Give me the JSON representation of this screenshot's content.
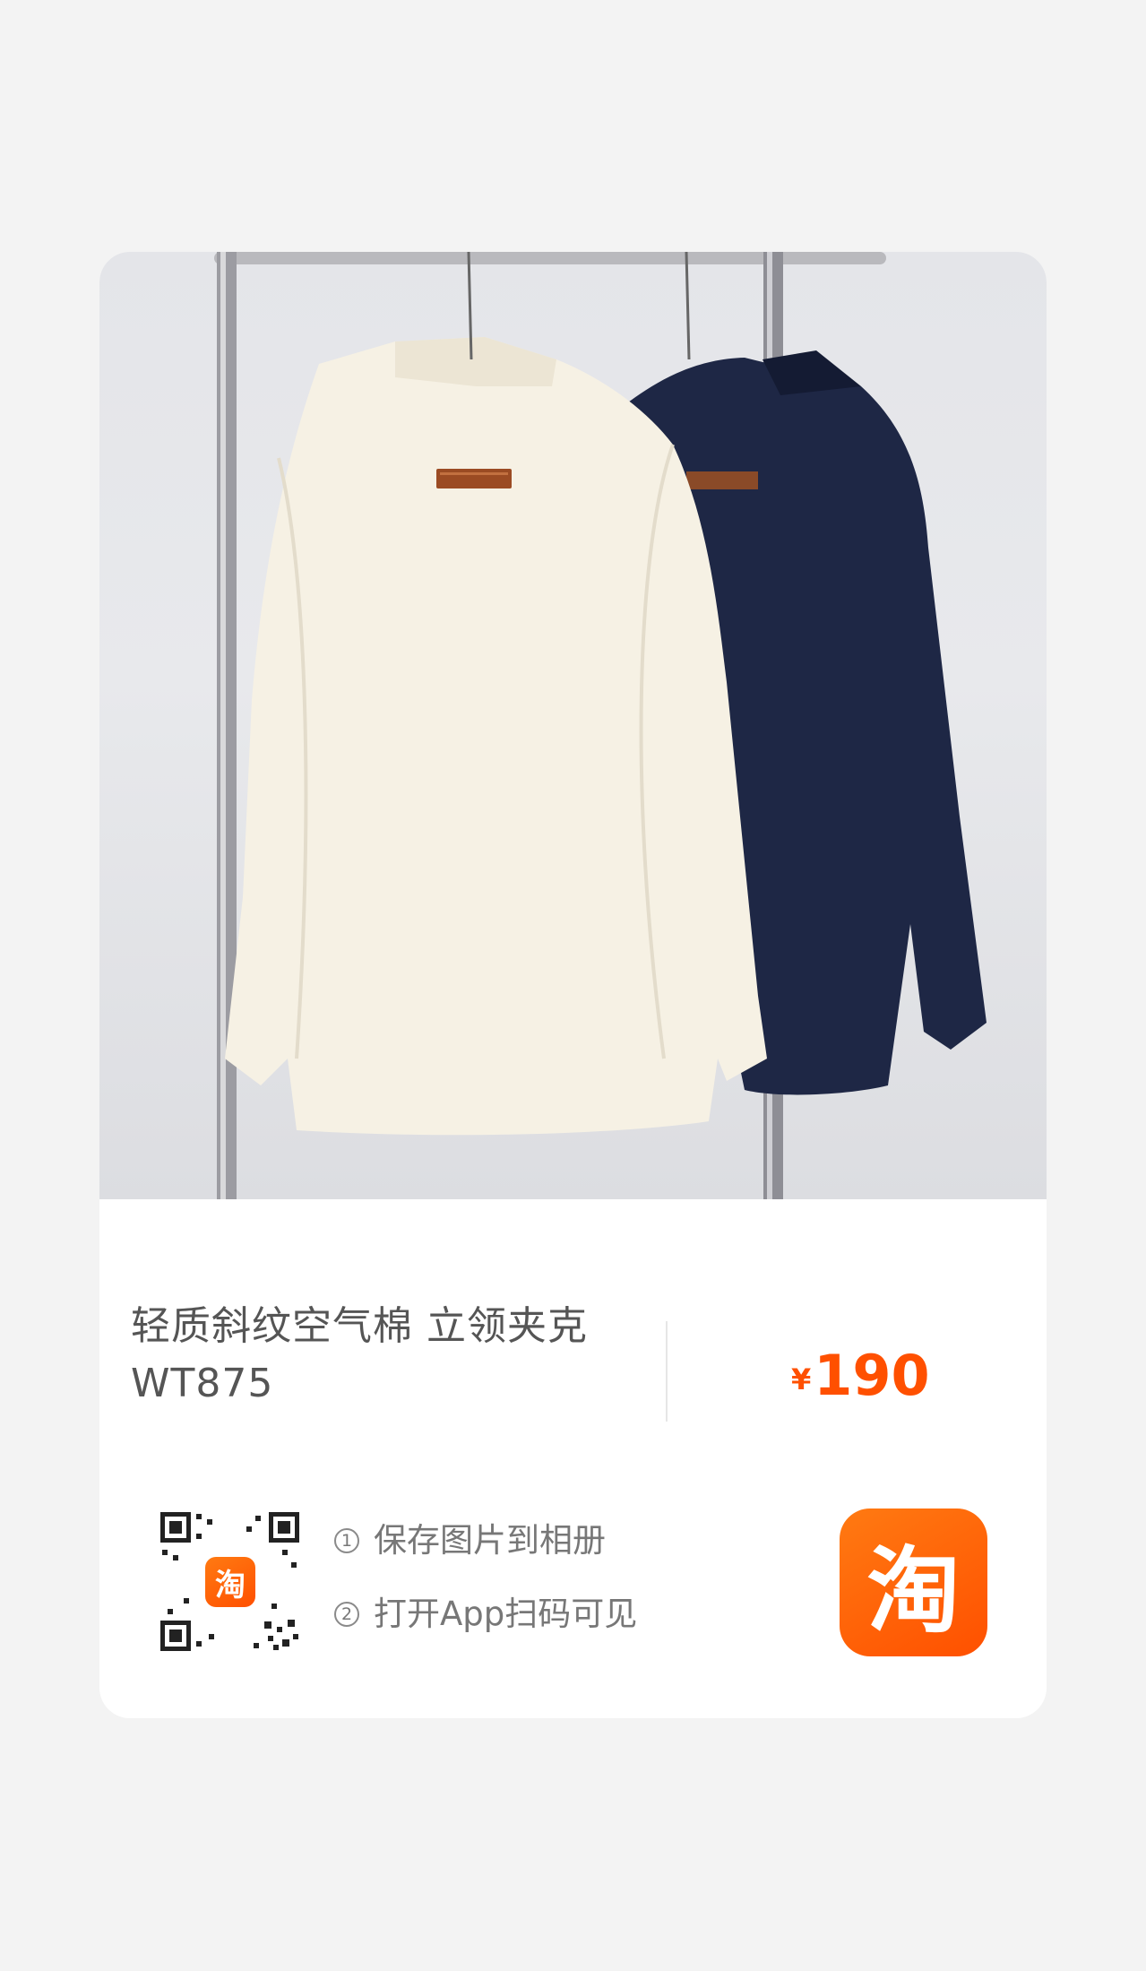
{
  "product": {
    "title": "轻质斜纹空气棉 立领夹克 WT875",
    "price_symbol": "¥",
    "price_value": "190",
    "image_alt_icon": "jacket-photo"
  },
  "share": {
    "step1_num": "①",
    "step1_text": "保存图片到相册",
    "step2_num": "②",
    "step2_text": "打开App扫码可见",
    "app_logo_char": "淘",
    "qr_logo_char": "淘"
  },
  "colors": {
    "price": "#ff5000",
    "brand": "#ff5000",
    "background": "#f3f3f3"
  }
}
